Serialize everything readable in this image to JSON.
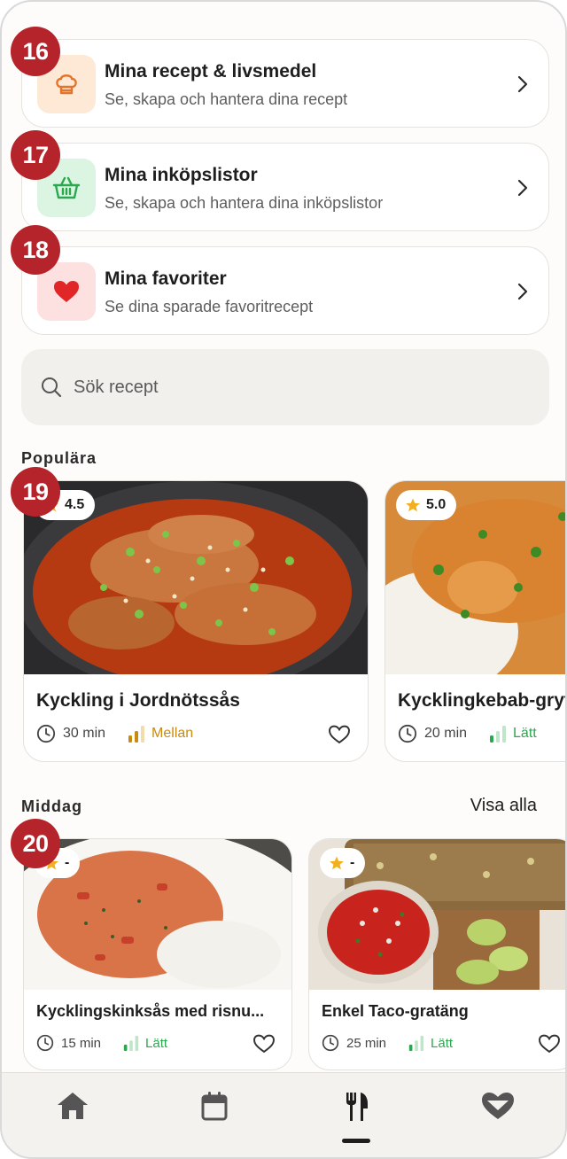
{
  "menu": [
    {
      "badge": "16",
      "title": "Mina recept & livsmedel",
      "subtitle": "Se, skapa och hantera dina recept",
      "icon": "chef-hat-icon",
      "icon_bg": "#fde9d6",
      "icon_color": "#e2752b"
    },
    {
      "badge": "17",
      "title": "Mina inköpslistor",
      "subtitle": "Se, skapa och hantera dina inköpslistor",
      "icon": "basket-icon",
      "icon_bg": "#dcf5e2",
      "icon_color": "#2aa84f"
    },
    {
      "badge": "18",
      "title": "Mina favoriter",
      "subtitle": "Se dina sparade favoritrecept",
      "icon": "heart-icon",
      "icon_bg": "#fde0e0",
      "icon_color": "#e02626"
    }
  ],
  "search": {
    "placeholder": "Sök recept"
  },
  "popular": {
    "title": "Populära",
    "badge": "19",
    "cards": [
      {
        "rating": "4.5",
        "title": "Kyckling i Jordnötssås",
        "time": "30 min",
        "difficulty": "Mellan",
        "difficulty_color": "#c98a10"
      },
      {
        "rating": "5.0",
        "title": "Kycklingkebab-gryta",
        "time": "20 min",
        "difficulty": "Lätt",
        "difficulty_color": "#2aa84f"
      }
    ]
  },
  "dinner": {
    "title": "Middag",
    "see_all": "Visa alla",
    "badge": "20",
    "cards": [
      {
        "rating": "-",
        "title": "Kycklingskinksås med risnu...",
        "time": "15 min",
        "difficulty": "Lätt",
        "difficulty_color": "#2aa84f"
      },
      {
        "rating": "-",
        "title": "Enkel Taco-gratäng",
        "time": "25 min",
        "difficulty": "Lätt",
        "difficulty_color": "#2aa84f"
      }
    ]
  },
  "nav": [
    "home-icon",
    "calendar-icon",
    "fork-knife-icon",
    "heart-hands-icon"
  ],
  "colors": {
    "badge": "#b5232b",
    "star": "#f2b01e",
    "accent_dark": "#1e1e1e"
  }
}
